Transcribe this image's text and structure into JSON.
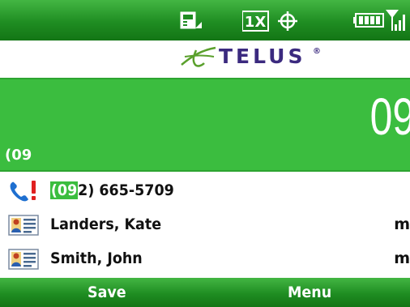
{
  "status_bar": {
    "icons": [
      "sim-card-icon",
      "1x-data-icon",
      "gps-crosshair-icon",
      "battery-icon",
      "signal-strength-icon"
    ],
    "onex_label": "1X"
  },
  "carrier": {
    "name": "TELUS",
    "registered_mark": "®",
    "logo": "telus-logo-icon"
  },
  "dialer": {
    "large_number": "09",
    "entry_text": "(09"
  },
  "results": [
    {
      "icon": "missed-call-icon",
      "match": "(09",
      "rest": "2) 665-5709",
      "type": ""
    },
    {
      "icon": "contact-card-icon",
      "name": "Landers, Kate",
      "type": "m"
    },
    {
      "icon": "contact-card-icon",
      "name": "Smith, John",
      "type": "m"
    }
  ],
  "softkeys": {
    "left": "Save",
    "right": "Menu"
  },
  "colors": {
    "bar_green": "#1f8d22",
    "dial_green": "#3bbd3f",
    "telus_purple": "#3b2a7f",
    "telus_green": "#5aa02c"
  }
}
